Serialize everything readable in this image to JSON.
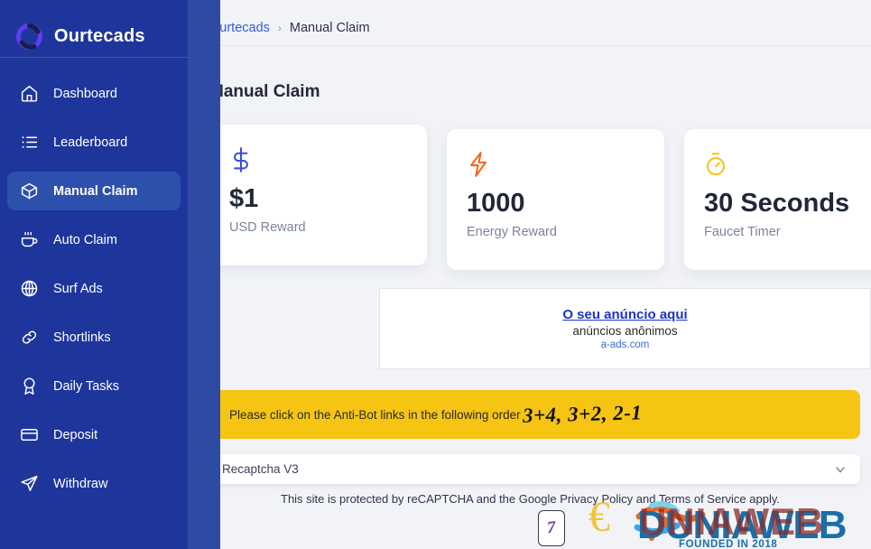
{
  "sidebar": {
    "brand": {
      "name": "Ourtecads",
      "logo_icon": "circle-ring-logo"
    },
    "items": [
      {
        "label": "Dashboard",
        "icon": "home-icon",
        "active": false
      },
      {
        "label": "Leaderboard",
        "icon": "list-icon",
        "active": false
      },
      {
        "label": "Manual Claim",
        "icon": "cube-icon",
        "active": true
      },
      {
        "label": "Auto Claim",
        "icon": "coffee-cup-icon",
        "active": false
      },
      {
        "label": "Surf Ads",
        "icon": "globe-icon",
        "active": false
      },
      {
        "label": "Shortlinks",
        "icon": "link-icon",
        "active": false
      },
      {
        "label": "Daily Tasks",
        "icon": "award-icon",
        "active": false
      },
      {
        "label": "Deposit",
        "icon": "credit-card-icon",
        "active": false
      },
      {
        "label": "Withdraw",
        "icon": "send-icon",
        "active": false
      }
    ]
  },
  "breadcrumb": {
    "root": "Ourtecads",
    "separator": "›",
    "current": "Manual Claim"
  },
  "page": {
    "title": "Manual Claim"
  },
  "cards": [
    {
      "icon": "dollar-sign-icon",
      "icon_color": "#3b4fd8",
      "value": "$1",
      "label": "USD Reward"
    },
    {
      "icon": "lightning-icon",
      "icon_color": "#f4681f",
      "value": "1000",
      "label": "Energy Reward"
    },
    {
      "icon": "stopwatch-icon",
      "icon_color": "#f5c518",
      "value": "30 Seconds",
      "label": "Faucet Timer"
    }
  ],
  "ad": {
    "title": "O seu anúncio aqui",
    "subtitle": "anúncios anônimos",
    "domain": "a-ads.com"
  },
  "alert": {
    "text": "Please click on the Anti-Bot links in the following order",
    "captcha": "3+4, 3+2, 2-1",
    "background": "#f6c413"
  },
  "captcha_select": {
    "value": "Recaptcha V3",
    "chevron_icon": "chevron-down-icon",
    "note": "This site is protected by reCAPTCHA and the Google Privacy Policy and Terms of Service apply."
  },
  "mini_captcha": {
    "value": "7"
  },
  "watermark": {
    "brand": "DUNIAWEB",
    "tagline": "FOUNDED IN 2018",
    "symbol": "€"
  },
  "colors": {
    "sidebar": "#1e369b",
    "sidebar_strip": "#2f4aa3",
    "sidebar_active": "#2e50ad",
    "main_bg": "#f1f3f7",
    "accent": "#3b5bdb"
  }
}
